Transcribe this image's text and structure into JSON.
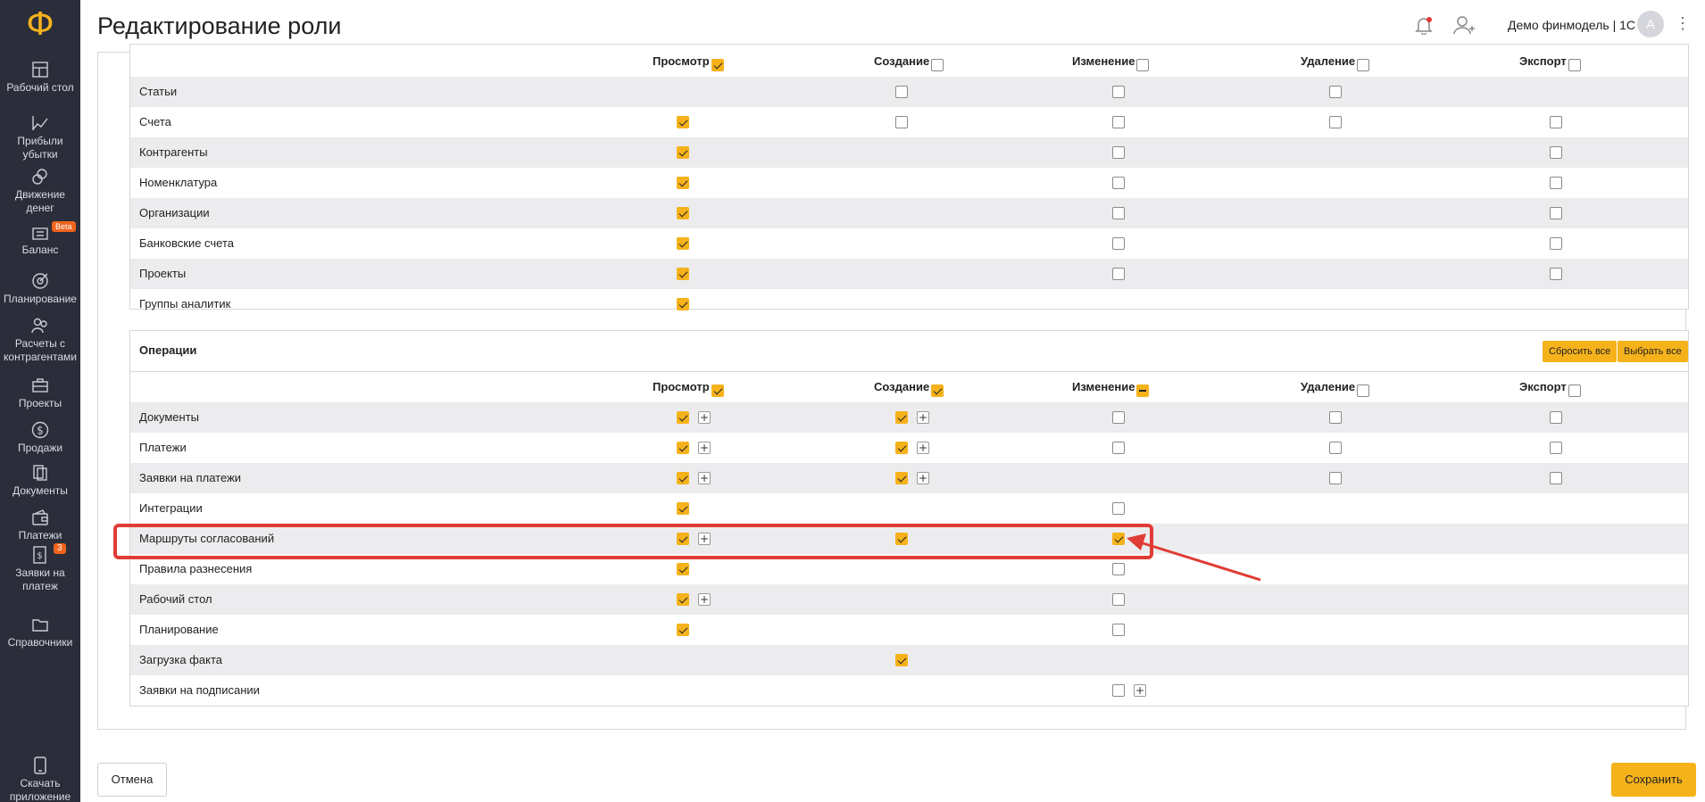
{
  "app": {
    "logo_glyph": "Ф"
  },
  "sidebar": {
    "items": [
      {
        "label": "Рабочий стол",
        "icon": "dashboard-icon"
      },
      {
        "label": "Прибыли убытки",
        "icon": "chart-icon"
      },
      {
        "label": "Движение денег",
        "icon": "coins-icon"
      },
      {
        "label": "Баланс",
        "icon": "balance-icon",
        "badge": "Beta"
      },
      {
        "label": "Планирование",
        "icon": "target-icon"
      },
      {
        "label": "Расчеты с контрагентами",
        "icon": "people-icon"
      },
      {
        "label": "Проекты",
        "icon": "briefcase-icon"
      },
      {
        "label": "Продажи",
        "icon": "dollar-icon"
      },
      {
        "label": "Документы",
        "icon": "documents-icon"
      },
      {
        "label": "Платежи",
        "icon": "wallet-icon"
      },
      {
        "label": "Заявки на платеж",
        "icon": "request-icon",
        "badge": "3"
      },
      {
        "label": "Справочники",
        "icon": "folder-icon"
      }
    ],
    "bottom": {
      "label": "Скачать приложение",
      "icon": "phone-icon"
    }
  },
  "header": {
    "title": "Редактирование роли",
    "user_name": "Демо финмодель | 1С",
    "avatar_letter": "А"
  },
  "columns": [
    "Просмотр",
    "Создание",
    "Изменение",
    "Удаление",
    "Экспорт"
  ],
  "directories": {
    "header_states": [
      "on",
      "off",
      "off",
      "off",
      "off"
    ],
    "rows": [
      {
        "label": "Статьи",
        "cells": [
          null,
          "off",
          "off",
          "off",
          null
        ]
      },
      {
        "label": "Счета",
        "cells": [
          "on",
          "off",
          "off",
          "off",
          "off"
        ]
      },
      {
        "label": "Контрагенты",
        "cells": [
          "on",
          null,
          "off",
          null,
          "off"
        ]
      },
      {
        "label": "Номенклатура",
        "cells": [
          "on",
          null,
          "off",
          null,
          "off"
        ]
      },
      {
        "label": "Организации",
        "cells": [
          "on",
          null,
          "off",
          null,
          "off"
        ]
      },
      {
        "label": "Банковские счета",
        "cells": [
          "on",
          null,
          "off",
          null,
          "off"
        ]
      },
      {
        "label": "Проекты",
        "cells": [
          "on",
          null,
          "off",
          null,
          "off"
        ]
      },
      {
        "label": "Группы аналитик",
        "cells": [
          "on",
          null,
          null,
          null,
          null
        ]
      }
    ]
  },
  "operations": {
    "title": "Операции",
    "reset_all": "Сбросить все",
    "select_all": "Выбрать все",
    "header_states": [
      "on",
      "on",
      "ind",
      "off",
      "off"
    ],
    "rows": [
      {
        "label": "Документы",
        "cells": [
          "on+",
          "on+",
          "off",
          "off",
          "off"
        ]
      },
      {
        "label": "Платежи",
        "cells": [
          "on+",
          "on+",
          "off",
          "off",
          "off"
        ]
      },
      {
        "label": "Заявки на платежи",
        "cells": [
          "on+",
          "on+",
          null,
          "off",
          "off"
        ]
      },
      {
        "label": "Интеграции",
        "cells": [
          "on",
          null,
          "off",
          null,
          null
        ]
      },
      {
        "label": "Маршруты согласований",
        "cells": [
          "on+",
          "on",
          "on",
          null,
          null
        ]
      },
      {
        "label": "Правила разнесения",
        "cells": [
          "on",
          null,
          "off",
          null,
          null
        ]
      },
      {
        "label": "Рабочий стол",
        "cells": [
          "on+",
          null,
          "off",
          null,
          null
        ]
      },
      {
        "label": "Планирование",
        "cells": [
          "on",
          null,
          "off",
          null,
          null
        ]
      },
      {
        "label": "Загрузка факта",
        "cells": [
          null,
          "on",
          null,
          null,
          null
        ]
      },
      {
        "label": "Заявки на подписании",
        "cells": [
          null,
          null,
          "off+",
          null,
          null
        ]
      }
    ]
  },
  "footer": {
    "cancel": "Отмена",
    "save": "Сохранить"
  },
  "colors": {
    "accent": "#f5b21b",
    "sidebar": "#2b2e3a",
    "annotation": "#e03c35"
  }
}
